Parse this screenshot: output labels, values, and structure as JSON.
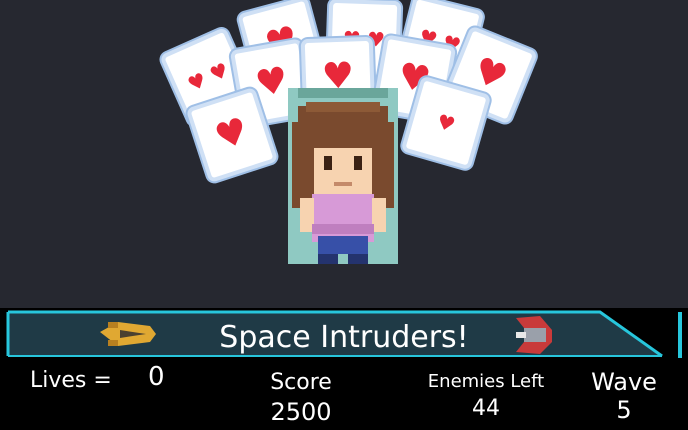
{
  "game": {
    "title": "Space Intruders!",
    "lives_label": "Lives =",
    "lives_value": "0",
    "score_label": "Score",
    "score_value": "2500",
    "enemies_label": "Enemies Left",
    "enemies_value": "44",
    "wave_label": "Wave",
    "wave_value": "5"
  },
  "icons": {
    "card": "heart-card-icon",
    "player_ship": "yellow-spaceship-icon",
    "enemy_ship": "red-spaceship-icon",
    "character": "girl-character-sprite"
  },
  "colors": {
    "background": "#262830",
    "hud_background": "#000000",
    "hud_accent": "#27c6dc",
    "heart": "#e8283a"
  }
}
